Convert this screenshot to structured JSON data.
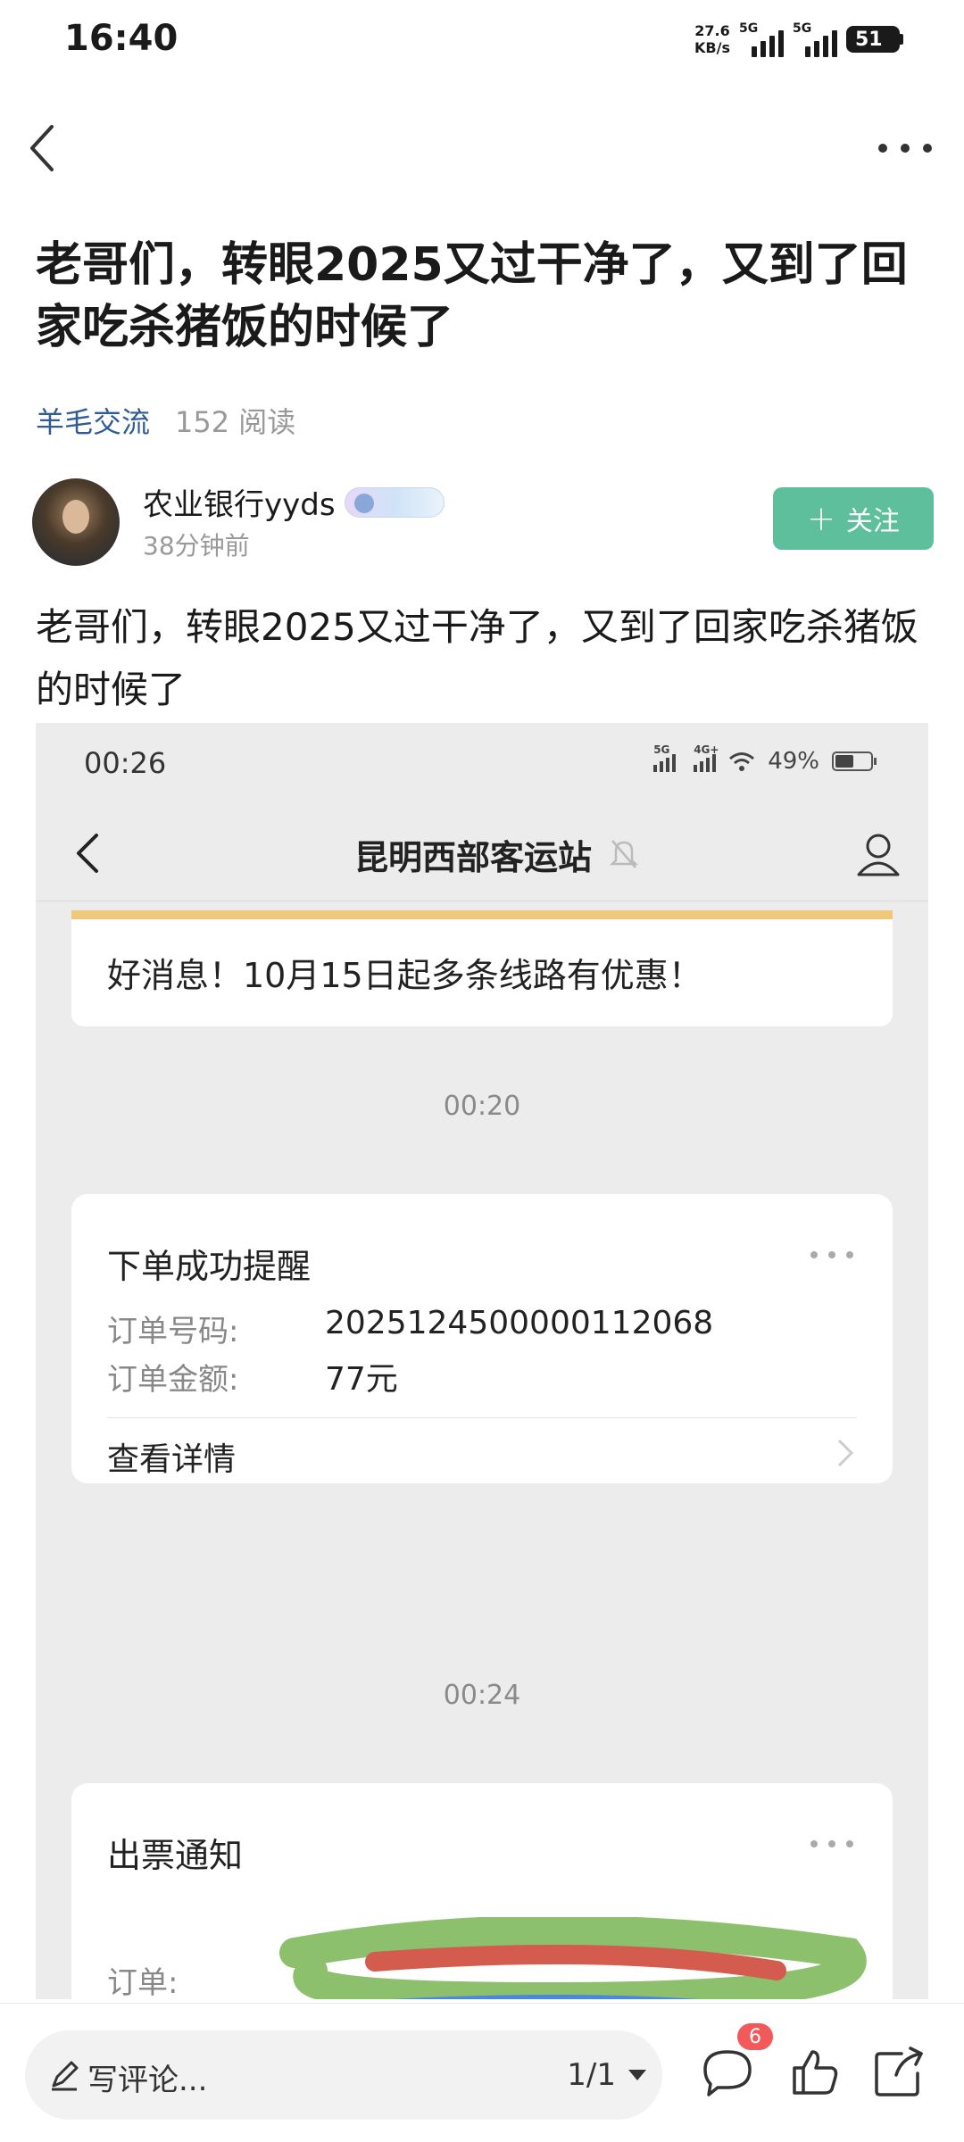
{
  "status_bar": {
    "time": "16:40",
    "net_speed_value": "27.6",
    "net_speed_unit": "KB/s",
    "sim1": "5G",
    "sim2": "5G",
    "battery": "51"
  },
  "post": {
    "title": "老哥们，转眼2025又过干净了，又到了回家吃杀猪饭的时候了",
    "category": "羊毛交流",
    "reads": "152 阅读",
    "author_name": "农业银行yyds",
    "post_time": "38分钟前",
    "follow_label": "关注",
    "body": "老哥们，转眼2025又过干净了，又到了回家吃杀猪饭的时候了"
  },
  "screenshot": {
    "time": "00:26",
    "battery": "49%",
    "net1": "5G",
    "net2": "4G+",
    "chat_title": "昆明西部客运站",
    "notice": "好消息！10月15日起多条线路有优惠！",
    "stamp1": "00:20",
    "card1": {
      "title": "下单成功提醒",
      "order_no_label": "订单号码:",
      "order_no": "20251245000001​12068",
      "amount_label": "订单金额:",
      "amount": "77元",
      "detail_link": "查看详情"
    },
    "stamp2": "00:24",
    "card2": {
      "title": "出票通知",
      "order_label": "订单:"
    }
  },
  "bottom_bar": {
    "comment_placeholder": "写评论...",
    "page_indicator": "1/1",
    "comment_count": "6"
  },
  "colors": {
    "accent_green": "#5dbf9b",
    "category_blue": "#2f5c93",
    "badge_red": "#f25a5a",
    "notice_yellow": "#efc87a"
  }
}
